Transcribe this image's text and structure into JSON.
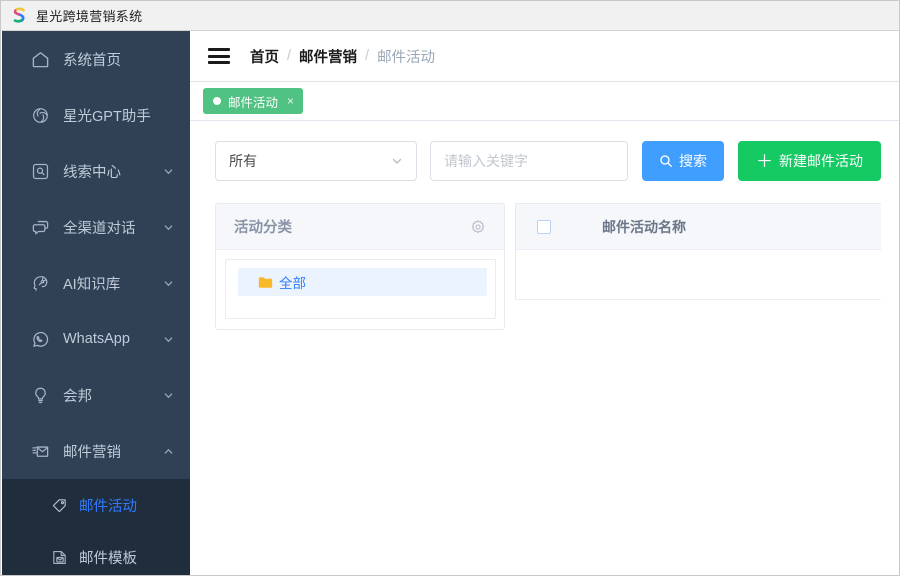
{
  "window": {
    "app_title": "星光跨境营销系统",
    "logo_icon": "s-letter-logo"
  },
  "sidebar": {
    "items": [
      {
        "label": "系统首页",
        "icon": "home-icon",
        "has_arrow": false,
        "expanded": false
      },
      {
        "label": "星光GPT助手",
        "icon": "gpt-spiral-icon",
        "has_arrow": false,
        "expanded": false
      },
      {
        "label": "线索中心",
        "icon": "clue-search-icon",
        "has_arrow": true,
        "expanded": false
      },
      {
        "label": "全渠道对话",
        "icon": "chat-bubble-icon",
        "has_arrow": true,
        "expanded": false
      },
      {
        "label": "AI知识库",
        "icon": "ai-head-icon",
        "has_arrow": true,
        "expanded": false
      },
      {
        "label": "WhatsApp",
        "icon": "whatsapp-icon",
        "has_arrow": true,
        "expanded": false
      },
      {
        "label": "会邦",
        "icon": "bulb-icon",
        "has_arrow": true,
        "expanded": false
      },
      {
        "label": "邮件营销",
        "icon": "mail-check-icon",
        "has_arrow": true,
        "expanded": true
      }
    ],
    "submenu": [
      {
        "label": "邮件活动",
        "icon": "tag-icon",
        "active": true
      },
      {
        "label": "邮件模板",
        "icon": "mail-template-icon",
        "active": false
      }
    ]
  },
  "topbar": {
    "menu_toggle_icon": "hamburger-icon",
    "breadcrumb": [
      {
        "label": "首页",
        "current": false
      },
      {
        "label": "邮件营销",
        "current": false
      },
      {
        "label": "邮件活动",
        "current": true
      }
    ],
    "breadcrumb_separator": "/"
  },
  "tabs": [
    {
      "label": "邮件活动",
      "active": true,
      "close_glyph": "×",
      "dot_icon": "status-dot-icon"
    }
  ],
  "toolbar": {
    "category_select": {
      "value": "所有",
      "caret_icon": "chevron-down-icon"
    },
    "keyword_input": {
      "value": "",
      "placeholder": "请输入关键字"
    },
    "search_button": {
      "label": "搜索",
      "icon": "search-icon",
      "color": "#409eff"
    },
    "create_button": {
      "label": "新建邮件活动",
      "icon": "plus-icon",
      "glyph": "＋",
      "color": "#15c963"
    }
  },
  "category_panel": {
    "title": "活动分类",
    "settings_icon": "gear-icon",
    "tree": [
      {
        "label": "全部",
        "icon": "folder-icon",
        "selected": true
      }
    ]
  },
  "list_panel": {
    "select_all_icon": "checkbox-icon",
    "columns": [
      {
        "label": "邮件活动名称"
      }
    ],
    "rows": []
  },
  "colors": {
    "sidebar_bg": "#304156",
    "submenu_bg": "#1f2d3d",
    "accent_blue": "#409eff",
    "accent_green": "#15c963",
    "tab_green": "#50c282",
    "active_link": "#2f7bff",
    "panel_head_bg": "#f5f7fa"
  }
}
